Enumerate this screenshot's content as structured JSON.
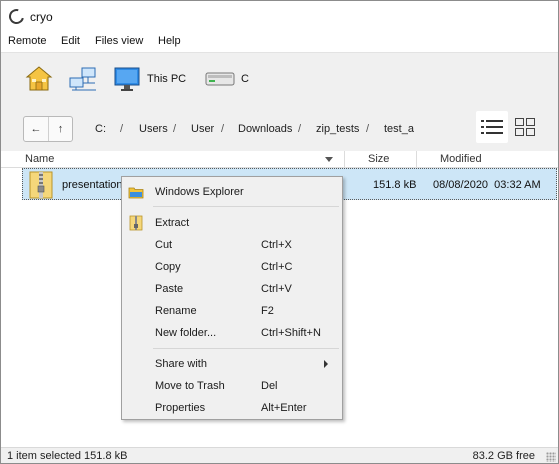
{
  "window": {
    "title": "cryo"
  },
  "menu": [
    "Remote",
    "Edit",
    "Files view",
    "Help"
  ],
  "locations": [
    {
      "icon": "home-icon",
      "label": ""
    },
    {
      "icon": "network-icon",
      "label": ""
    },
    {
      "icon": "monitor-icon",
      "label": "This PC"
    },
    {
      "icon": "drive-icon",
      "label": "C"
    }
  ],
  "nav": {
    "back": "←",
    "up": "↑"
  },
  "breadcrumb": [
    "C:",
    "Users",
    "User",
    "Downloads",
    "zip_tests",
    "test_a"
  ],
  "breadcrumb_sep": "/",
  "columns": {
    "name": "Name",
    "size": "Size",
    "modified": "Modified"
  },
  "files": [
    {
      "name": "presentation",
      "size": "151.8 kB",
      "modified": "08/08/2020  03:32 AM",
      "icon": "zip-folder-icon",
      "selected": true
    }
  ],
  "context_menu": {
    "open_with": "Windows Explorer",
    "items": [
      {
        "label": "Extract",
        "shortcut": ""
      },
      {
        "label": "Cut",
        "shortcut": "Ctrl+X"
      },
      {
        "label": "Copy",
        "shortcut": "Ctrl+C"
      },
      {
        "label": "Paste",
        "shortcut": "Ctrl+V"
      },
      {
        "label": "Rename",
        "shortcut": "F2"
      },
      {
        "label": "New folder...",
        "shortcut": "Ctrl+Shift+N"
      }
    ],
    "share_with": "Share with",
    "move_to_trash": {
      "label": "Move to Trash",
      "shortcut": "Del"
    },
    "properties": {
      "label": "Properties",
      "shortcut": "Alt+Enter"
    }
  },
  "status": {
    "selection": "1 item selected 151.8 kB",
    "free": "83.2 GB free"
  },
  "colors": {
    "selection": "#cde6f7",
    "toolbar": "#f0f0f0",
    "folder": "#f2c43b"
  }
}
